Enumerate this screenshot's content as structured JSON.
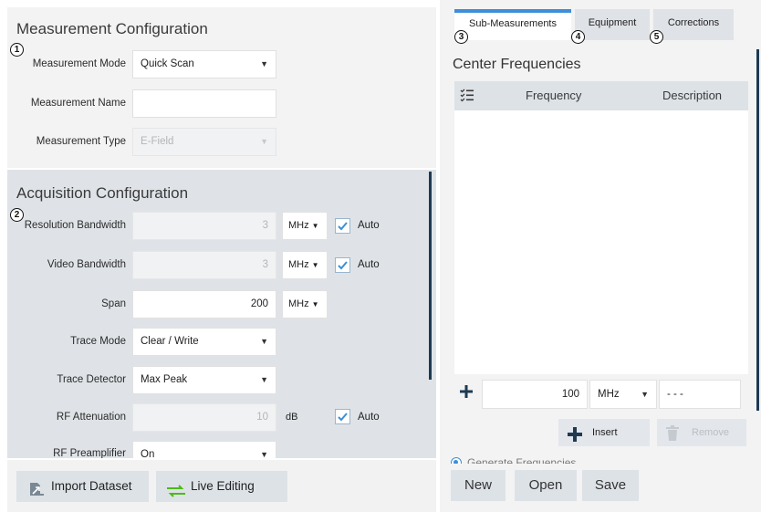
{
  "measurement_config": {
    "title": "Measurement Configuration",
    "callout": "1",
    "mode_label": "Measurement Mode",
    "mode_value": "Quick Scan",
    "name_label": "Measurement Name",
    "name_value": "",
    "type_label": "Measurement Type",
    "type_value": "E-Field"
  },
  "acquisition_config": {
    "title": "Acquisition Configuration",
    "callout": "2",
    "rows": {
      "rbw": {
        "label": "Resolution Bandwidth",
        "value": "3",
        "unit": "MHz",
        "auto": "Auto"
      },
      "vbw": {
        "label": "Video Bandwidth",
        "value": "3",
        "unit": "MHz",
        "auto": "Auto"
      },
      "span": {
        "label": "Span",
        "value": "200",
        "unit": "MHz"
      },
      "trace_mode": {
        "label": "Trace Mode",
        "value": "Clear / Write"
      },
      "trace_detector": {
        "label": "Trace Detector",
        "value": "Max Peak"
      },
      "rf_att": {
        "label": "RF Attenuation",
        "value": "10",
        "unit": "dB",
        "auto": "Auto"
      },
      "rf_preamp": {
        "label": "RF Preamplifier",
        "value": "On"
      }
    }
  },
  "bottom_left": {
    "import_label": "Import Dataset",
    "live_label": "Live Editing"
  },
  "tabs": {
    "sub": {
      "label": "Sub-Measurements",
      "callout": "3"
    },
    "equipment": {
      "label": "Equipment",
      "callout": "4"
    },
    "corrections": {
      "label": "Corrections",
      "callout": "5"
    }
  },
  "center_freq": {
    "title": "Center Frequencies",
    "columns": {
      "frequency": "Frequency",
      "description": "Description"
    },
    "new_entry": {
      "value": "100",
      "unit": "MHz",
      "description": "- - -"
    },
    "insert_label": "Insert",
    "remove_label": "Remove",
    "generate_label": "Generate Frequencies"
  },
  "bottom_right": {
    "new_label": "New",
    "open_label": "Open",
    "save_label": "Save"
  },
  "colors": {
    "accent": "#3c8fd8",
    "add_icon": "#1e3a52",
    "live_icon": "#4cbb17",
    "check": "#3c8fd8"
  }
}
